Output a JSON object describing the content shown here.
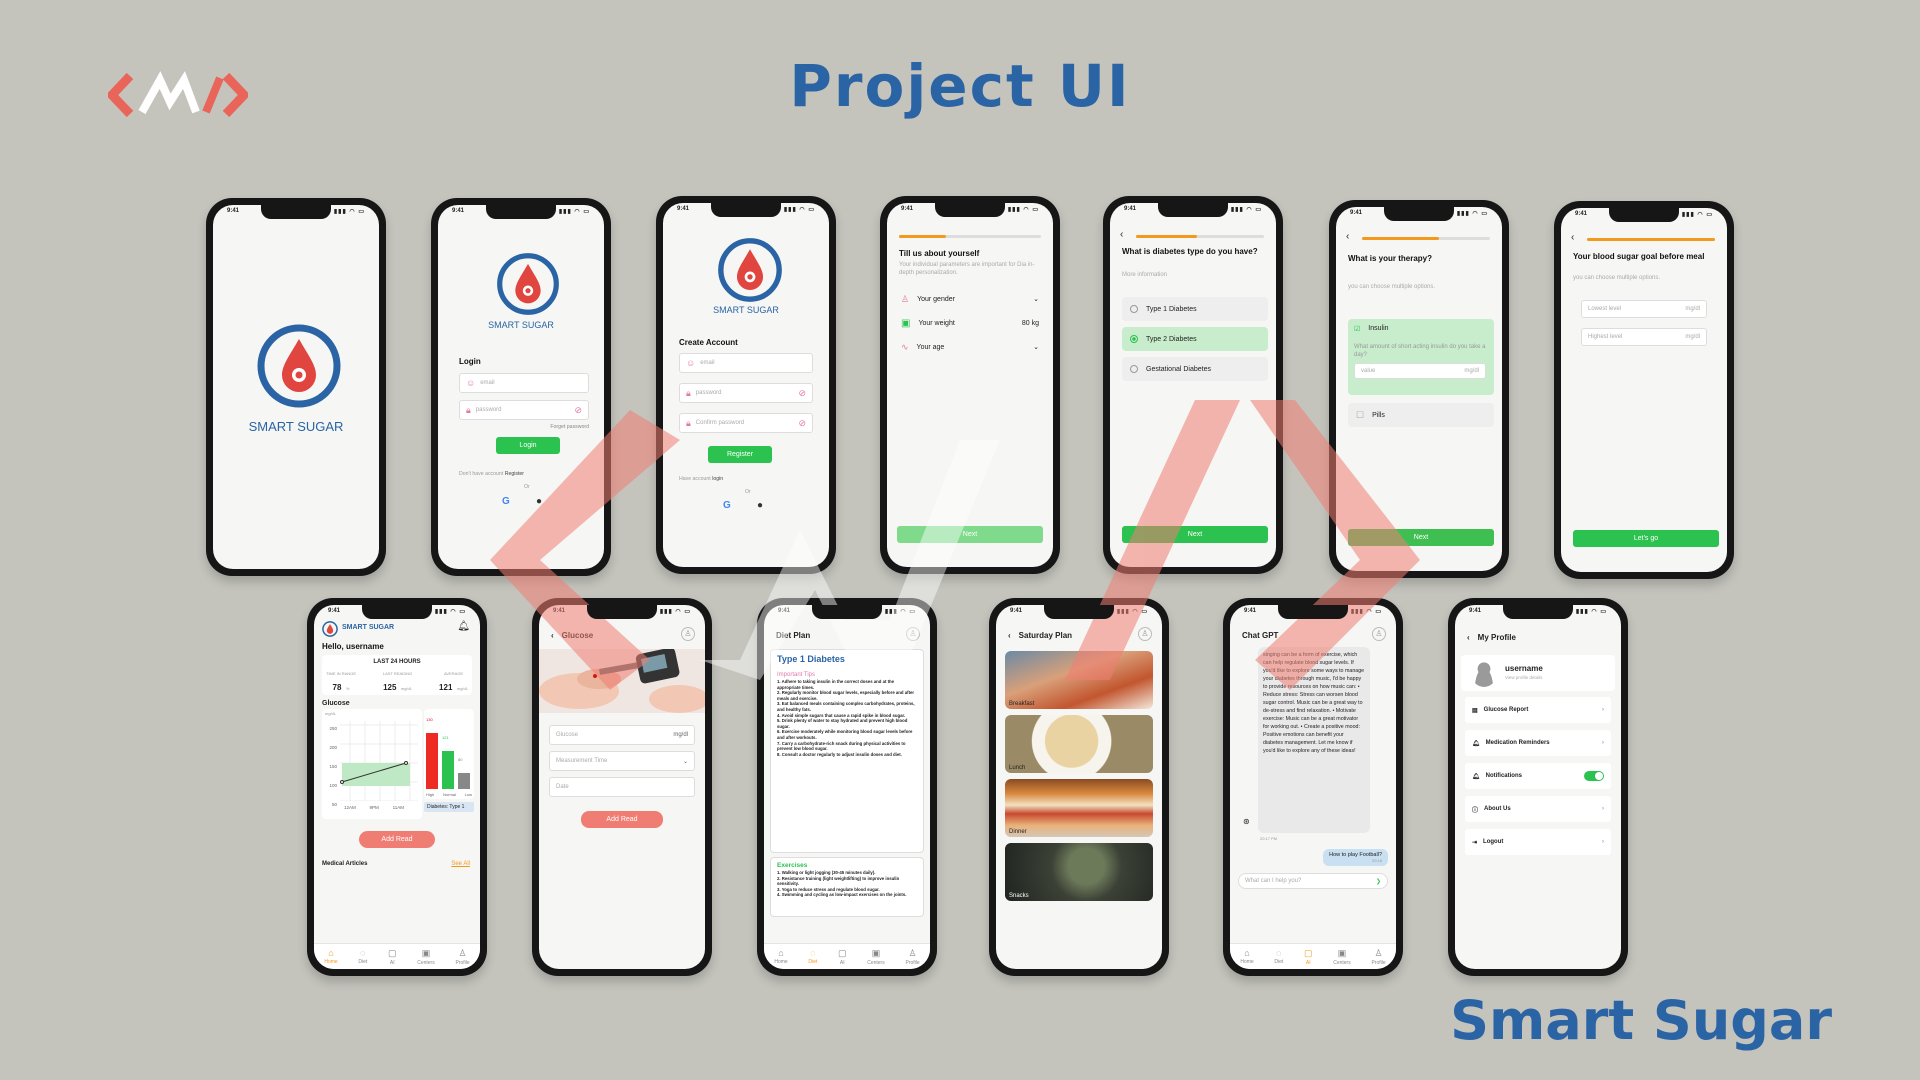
{
  "page_title": "Project UI",
  "brand_name": "Smart Sugar",
  "colors": {
    "accent_blue": "#2b64a4",
    "green": "#2bc24f",
    "red": "#f07d73",
    "orange": "#f39a1e",
    "bg": "#c4c4bd"
  },
  "common": {
    "time": "9:41",
    "signal": "▮▮▮ ◠ ▭"
  },
  "splash": {
    "app_name": "SMART SUGAR"
  },
  "login": {
    "app_name": "SMART SUGAR",
    "heading": "Login",
    "email_placeholder": "email",
    "password_placeholder": "password",
    "forgot": "Forget password",
    "button": "Login",
    "no_account": "Don't have account",
    "register_link": "Register",
    "or": "Or"
  },
  "register": {
    "app_name": "SMART SUGAR",
    "heading": "Create Account",
    "email_placeholder": "email",
    "password_placeholder": "password",
    "confirm_placeholder": "Confirm password",
    "button": "Register",
    "have_account": "Have account",
    "login_link": "login",
    "or": "Or"
  },
  "about": {
    "heading": "Till us about yourself",
    "subtitle": "Your individual parameters are important for Dia in-depth personalization.",
    "gender": "Your gender",
    "weight": "Your weight",
    "weight_value": "80 kg",
    "age": "Your age",
    "button": "Next"
  },
  "dtype": {
    "heading": "What is diabetes type do you have?",
    "subtitle": "More information",
    "options": [
      "Type 1 Diabetes",
      "Type 2 Diabetes",
      "Gestational Diabetes"
    ],
    "button": "Next"
  },
  "therapy": {
    "heading": "What is your therapy?",
    "subtitle": "you can choose multiple options.",
    "insulin": "Insulin",
    "insulin_q": "What amount of short acting insulin do you take a day?",
    "value_placeholder": "value",
    "unit": "mg/dl",
    "pills": "Pills",
    "button": "Next"
  },
  "goal": {
    "heading": "Your blood sugar goal before meal",
    "subtitle": "you can choose multiple options.",
    "lowest": "Lowest level",
    "highest": "Highest level",
    "unit": "mg/dl",
    "button": "Let's go"
  },
  "home": {
    "app_name": "SMART SUGAR",
    "greeting": "Hello, username",
    "period": "LAST 24 HOURS",
    "stats": [
      {
        "label": "TIME IN RANGE",
        "value": "78",
        "unit": "%"
      },
      {
        "label": "LAST READING",
        "value": "125",
        "unit": "mg/dL"
      },
      {
        "label": "AVERAGE",
        "value": "121",
        "unit": "mg/dL"
      }
    ],
    "glucose_label": "Glucose",
    "unit": "mg/dL",
    "y_ticks": [
      "250",
      "200",
      "150",
      "100",
      "50"
    ],
    "x_ticks": [
      "12AM",
      "9PM",
      "11AM"
    ],
    "bars": [
      {
        "label": "High",
        "value": "130",
        "unit": "mg/dL"
      },
      {
        "label": "Normal",
        "value": "121",
        "unit": "mg/dL"
      },
      {
        "label": "Low",
        "value": "80",
        "unit": "mg/dL"
      }
    ],
    "diabetes_tag": "Diabetes: Type 1",
    "button": "Add Read",
    "articles": "Medical Articles",
    "see_all": "See All"
  },
  "tabs": [
    "Home",
    "Diet",
    "AI",
    "Centers",
    "Profile"
  ],
  "glucose": {
    "title": "Glucose",
    "glucose_placeholder": "Glucose",
    "unit": "mg/dl",
    "time_placeholder": "Measurement Time",
    "date_placeholder": "Date",
    "button": "Add Read"
  },
  "diet": {
    "title": "Diet Plan",
    "heading": "Type 1 Diabetes",
    "tips_heading": "Important Tips",
    "tips": "1. Adhere to taking insulin in the correct doses and at the appropriate times.\n2. Regularly monitor blood sugar levels, especially before and after meals and exercise.\n3. Eat balanced meals containing complex carbohydrates, proteins, and healthy fats.\n4. Avoid simple sugars that cause a rapid spike in blood sugar.\n5. Drink plenty of water to stay hydrated and prevent high blood sugar.\n6. Exercise moderately while monitoring blood sugar levels before and after workouts.\n7. Carry a carbohydrate-rich snack during physical activities to prevent low blood sugar.\n8. Consult a doctor regularly to adjust insulin doses and diet.",
    "ex_heading": "Exercises",
    "exercises": "1. Walking or light jogging (30-45 minutes daily).\n2. Resistance training (light weightlifting) to improve insulin sensitivity.\n3. Yoga to reduce stress and regulate blood sugar.\n4. Swimming and cycling as low-impact exercises on the joints."
  },
  "plan": {
    "title": "Saturday Plan",
    "meals": [
      "Breakfast",
      "Lunch",
      "Dinner",
      "Snacks"
    ]
  },
  "chat": {
    "title": "Chat GPT",
    "bot_message": "singing can be a form of exercise, which can help regulate blood sugar levels. If you'd like to explore some ways to manage your diabetes through music, I'd be happy to provide resources on how music can: • Reduce stress: Stress can worsen blood sugar control. Music can be a great way to de-stress and find relaxation. • Motivate exercise: Music can be a great motivator for working out. • Create a positive mood: Positive emotions can benefit your diabetes management. Let me know if you'd like to explore any of these ideas!",
    "bot_time": "20:17 PM",
    "user_message": "How to play Football?",
    "user_time": "20:18",
    "placeholder": "What can I help you?"
  },
  "profile": {
    "title": "My Profile",
    "username": "username",
    "view": "View profile details",
    "items": [
      "Glucose Report",
      "Medication Reminders",
      "Notifications",
      "About Us",
      "Logout"
    ]
  }
}
